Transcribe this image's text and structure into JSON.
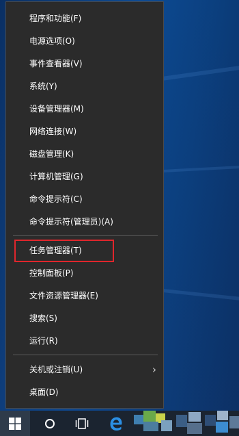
{
  "menu": {
    "items": [
      {
        "label": "程序和功能(F)"
      },
      {
        "label": "电源选项(O)"
      },
      {
        "label": "事件查看器(V)"
      },
      {
        "label": "系统(Y)"
      },
      {
        "label": "设备管理器(M)"
      },
      {
        "label": "网络连接(W)"
      },
      {
        "label": "磁盘管理(K)"
      },
      {
        "label": "计算机管理(G)"
      },
      {
        "label": "命令提示符(C)"
      },
      {
        "label": "命令提示符(管理员)(A)"
      },
      {
        "label": "任务管理器(T)"
      },
      {
        "label": "控制面板(P)"
      },
      {
        "label": "文件资源管理器(E)"
      },
      {
        "label": "搜索(S)"
      },
      {
        "label": "运行(R)"
      },
      {
        "label": "关机或注销(U)"
      },
      {
        "label": "桌面(D)"
      }
    ],
    "highlight_color": "#e0262c",
    "submenu_arrow": "›"
  },
  "taskbar": {
    "icons": [
      "windows-logo-icon",
      "cortana-circle-icon",
      "task-view-icon",
      "edge-browser-icon"
    ],
    "accent": "#1e90ff"
  }
}
